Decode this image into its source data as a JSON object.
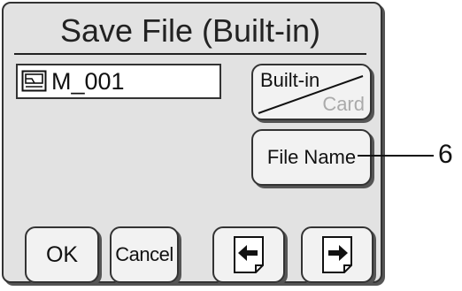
{
  "dialog": {
    "title": "Save File (Built-in)"
  },
  "file_field": {
    "value": "M_001",
    "icon": "file-icon"
  },
  "media_toggle": {
    "selected": "Built-in",
    "other": "Card"
  },
  "buttons": {
    "file_name": "File Name",
    "ok": "OK",
    "cancel": "Cancel",
    "prev_icon": "arrow-left-icon",
    "next_icon": "arrow-right-icon"
  },
  "callout": {
    "label": "6"
  }
}
